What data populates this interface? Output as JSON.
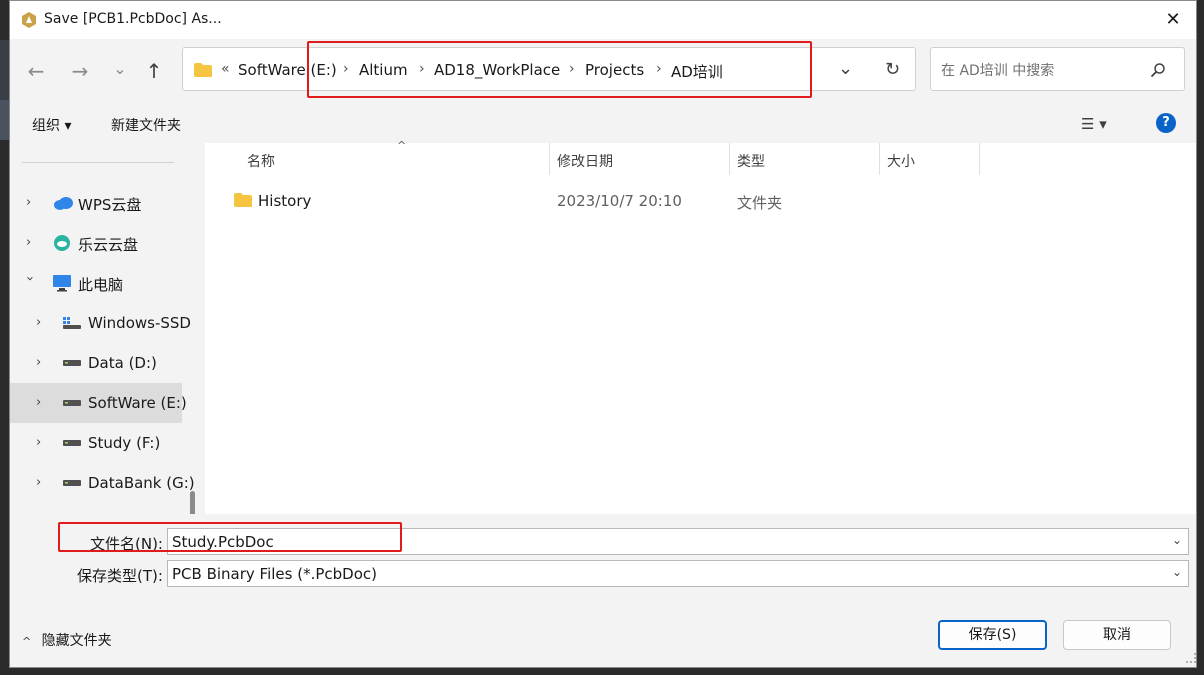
{
  "window": {
    "title": "Save [PCB1.PcbDoc] As...",
    "close_glyph": "✕"
  },
  "nav": {
    "back_glyph": "←",
    "forward_glyph": "→",
    "recent_glyph": "⌄",
    "up_glyph": "↑"
  },
  "address": {
    "overflow_glyph": "«",
    "separator": "›",
    "crumbs": [
      "SoftWare (E:)",
      "Altium",
      "AD18_WorkPlace",
      "Projects",
      "AD培训"
    ],
    "dropdown_glyph": "⌄",
    "refresh_glyph": "↻"
  },
  "search": {
    "placeholder": "在 AD培训 中搜索"
  },
  "toolbar": {
    "organize_label": "组织 ▾",
    "new_folder_label": "新建文件夹",
    "view_glyph": "☰ ▾",
    "help_glyph": "?"
  },
  "sidebar": {
    "items": [
      {
        "label": "WPS云盘",
        "icon": "cloud-icon",
        "expanded": false,
        "selected": false
      },
      {
        "label": "乐云云盘",
        "icon": "cloud-drive-icon",
        "expanded": false,
        "selected": false
      },
      {
        "label": "此电脑",
        "icon": "computer-icon",
        "expanded": true,
        "selected": false
      },
      {
        "label": "Windows-SSD",
        "icon": "system-drive-icon",
        "expanded": false,
        "selected": false
      },
      {
        "label": "Data (D:)",
        "icon": "drive-icon",
        "expanded": false,
        "selected": false
      },
      {
        "label": "SoftWare (E:)",
        "icon": "drive-icon",
        "expanded": false,
        "selected": true
      },
      {
        "label": "Study (F:)",
        "icon": "drive-icon",
        "expanded": false,
        "selected": false
      },
      {
        "label": "DataBank (G:)",
        "icon": "drive-icon",
        "expanded": false,
        "selected": false
      }
    ]
  },
  "files": {
    "columns": [
      "名称",
      "修改日期",
      "类型",
      "大小"
    ],
    "sort_glyph": "^",
    "rows": [
      {
        "name": "History",
        "modified": "2023/10/7 20:10",
        "type": "文件夹",
        "size": ""
      }
    ]
  },
  "form": {
    "filename_label": "文件名(N):",
    "filename_value": "Study.PcbDoc",
    "filetype_label": "保存类型(T):",
    "filetype_value": "PCB Binary Files (*.PcbDoc)",
    "dropdown_glyph": "⌄"
  },
  "footer": {
    "hide_folders_label": "隐藏文件夹",
    "hide_glyph": "^",
    "save_label": "保存(S)",
    "cancel_label": "取消"
  },
  "colors": {
    "highlight_box": "#e01b1b",
    "primary_button_border": "#0a64c8",
    "help_icon": "#0a64c8",
    "folder": "#f5c542"
  }
}
